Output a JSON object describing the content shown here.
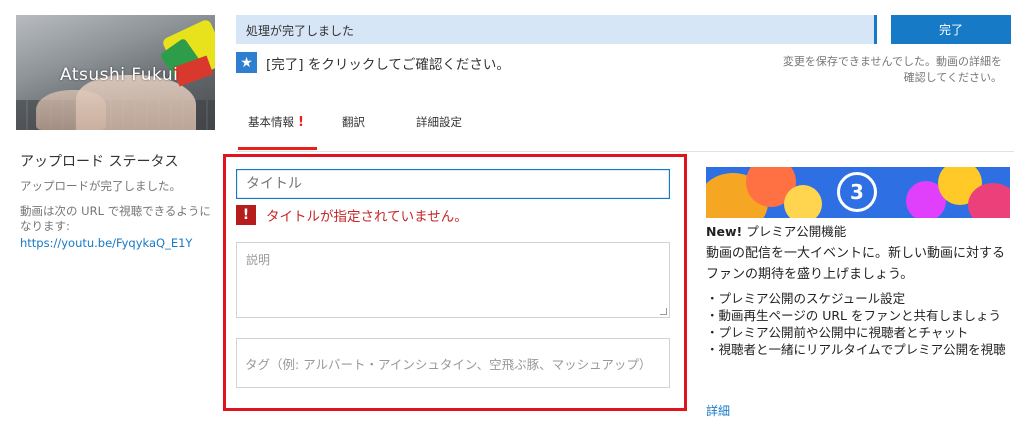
{
  "thumbnail": {
    "name_text": "Atsushi Fukui"
  },
  "upload_status": {
    "heading": "アップロード ステータス",
    "complete_text": "アップロードが完了しました。",
    "url_text": "動画は次の URL で視聴できるようになります:",
    "url": "https://youtu.be/FyqykaQ_E1Y"
  },
  "progress": {
    "text": "処理が完了しました",
    "percent": 100
  },
  "done_button": "完了",
  "notice": {
    "icon": "star-icon",
    "text": "[完了] をクリックしてご確認ください。"
  },
  "save_warning": "変更を保存できませんでした。動画の詳細を確認してください。",
  "tabs": [
    {
      "label": "基本情報",
      "alert": "!"
    },
    {
      "label": "翻訳"
    },
    {
      "label": "詳細設定"
    }
  ],
  "form": {
    "title_placeholder": "タイトル",
    "error_icon": "!",
    "error_text": "タイトルが指定されていません。",
    "description_placeholder": "説明",
    "tags_placeholder": "タグ（例: アルバート・アインシュタイン、空飛ぶ豚、マッシュアップ）"
  },
  "promo": {
    "banner_number": "3",
    "new_label": "New!",
    "title": "プレミア公開機能",
    "body": "動画の配信を一大イベントに。新しい動画に対するファンの期待を盛り上げましょう。",
    "bullets": [
      "・プレミア公開のスケジュール設定",
      "・動画再生ページの URL をファンと共有しましょう",
      "・プレミア公開前や公開中に視聴者とチャット",
      "・視聴者と一緒にリアルタイムでプレミア公開を視聴"
    ],
    "more_link": "詳細"
  },
  "colors": {
    "accent": "#167ac6",
    "error": "#e62117",
    "highlight_box": "#e0141e"
  }
}
